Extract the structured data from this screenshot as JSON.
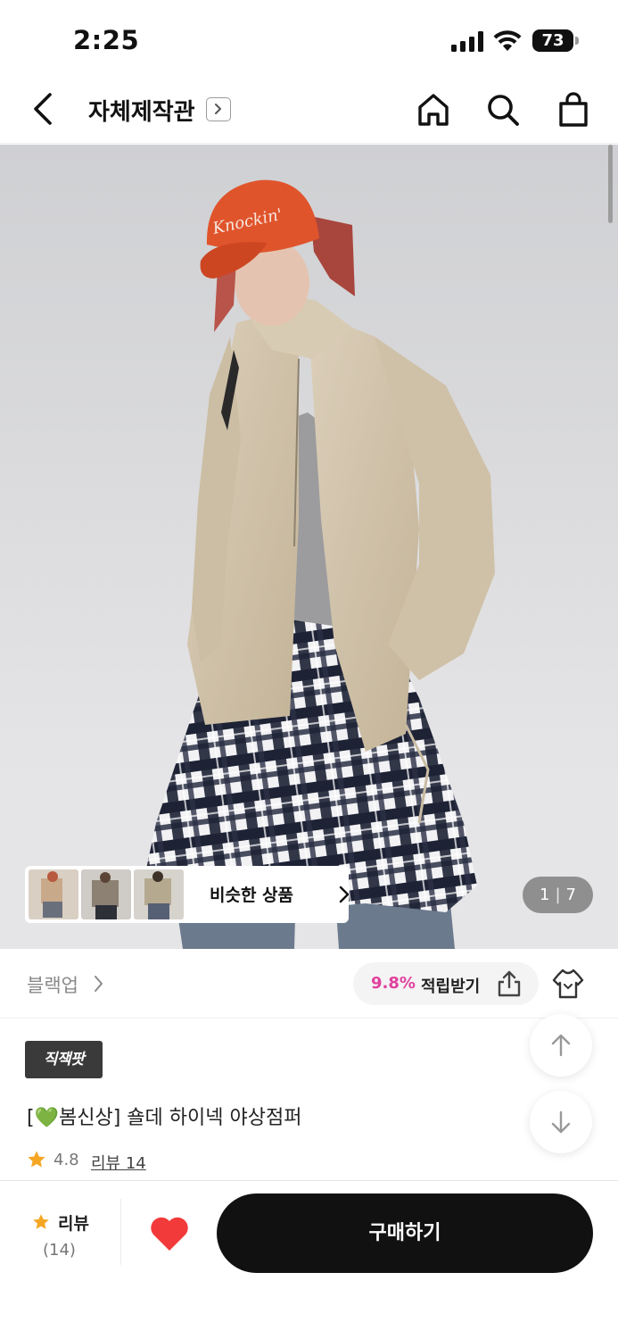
{
  "status_bar": {
    "time": "2:25",
    "battery": "73"
  },
  "header": {
    "title": "자체제작관"
  },
  "hero": {
    "similar_label": "비슷한 상품",
    "page_current": "1",
    "page_total": "7"
  },
  "info": {
    "category": "블랙업",
    "points_rate": "9.8%",
    "points_label": "적립받기"
  },
  "product": {
    "badge": "직잭팟",
    "title_prefix": "[",
    "title_emoji": "💚",
    "title_rest": "봄신상] 숄데 하이넥 야상점퍼",
    "rating": "4.8",
    "review_link": "리뷰 14"
  },
  "bottom_bar": {
    "review_label": "리뷰",
    "review_count": "(14)",
    "buy_label": "구매하기"
  },
  "colors": {
    "accent_pink": "#e0419c",
    "heart_red": "#f23a3a",
    "star_orange": "#f5a623",
    "buy_button": "#111111"
  },
  "icons": [
    "back-arrow-icon",
    "chevron-right-icon",
    "home-icon",
    "search-icon",
    "shopping-bag-icon",
    "share-icon",
    "fitting-hanger-icon",
    "star-icon",
    "arrow-up-icon",
    "arrow-down-icon",
    "heart-icon"
  ]
}
